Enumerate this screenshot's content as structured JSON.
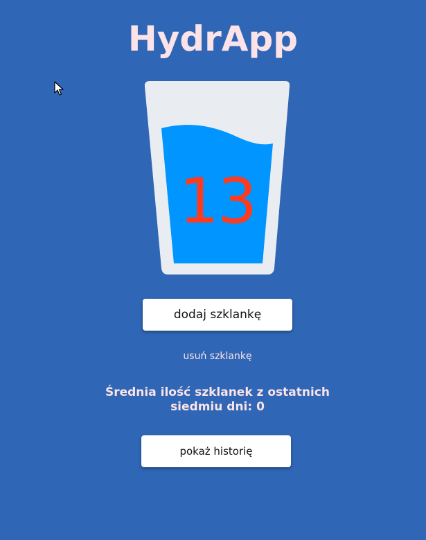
{
  "app": {
    "title": "HydrApp"
  },
  "counter": {
    "glasses": "13"
  },
  "actions": {
    "add_label": "dodaj szklankę",
    "remove_label": "usuń szklankę",
    "history_label": "pokaż historię"
  },
  "stats": {
    "average_text": "Średnia ilość szklanek z ostatnich siedmiu dni: 0"
  },
  "colors": {
    "background": "#2f66b5",
    "title": "#fbe3e8",
    "glass": "#e9edf1",
    "water": "#0095ff",
    "count": "#ff3b1f"
  },
  "icons": {
    "cursor": "mouse-pointer-icon",
    "glass": "water-glass-icon"
  }
}
